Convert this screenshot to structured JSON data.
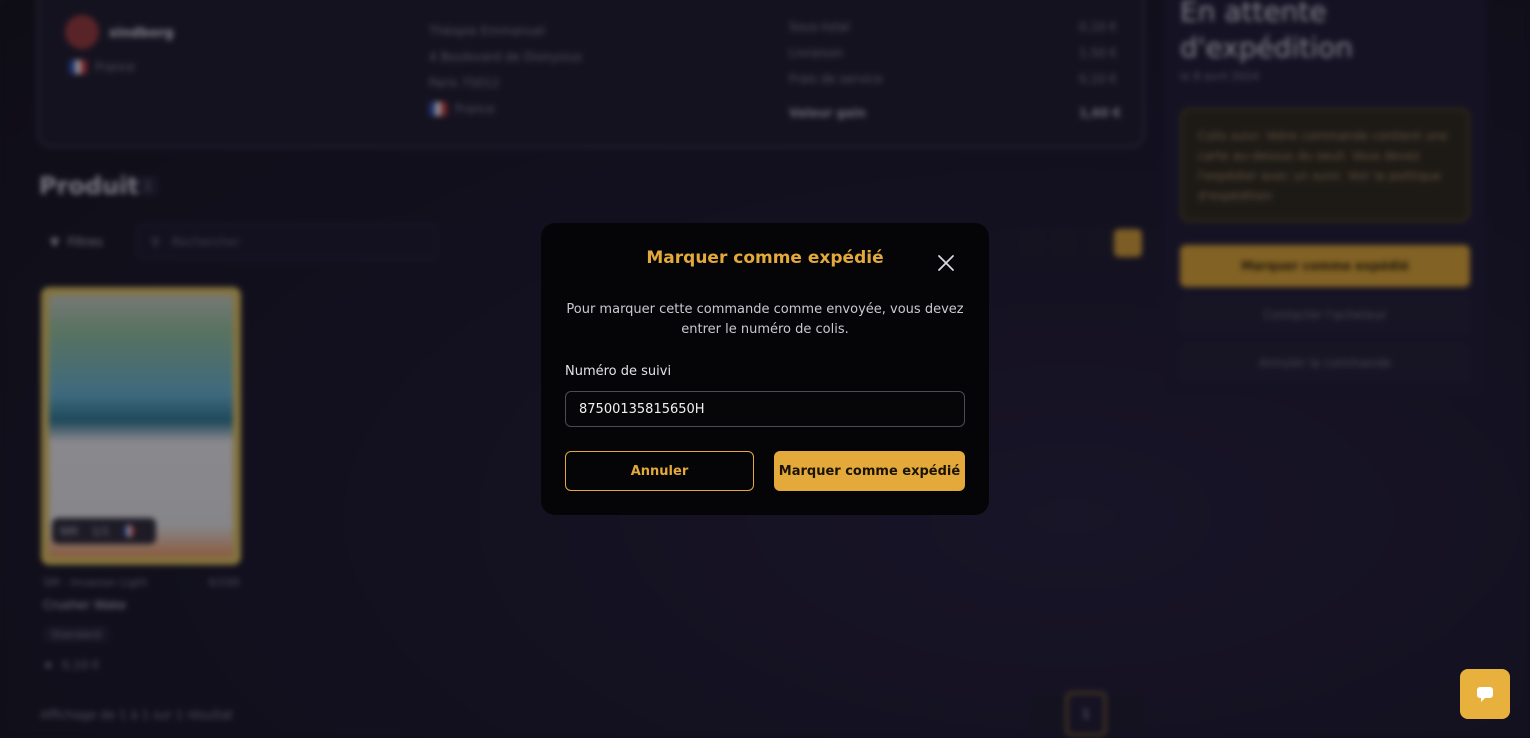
{
  "background": {
    "seller": {
      "name": "sindborg",
      "country": "France"
    },
    "address": {
      "lines": [
        "Théopie Emmanuel",
        "4 Boulevard de Dionysius",
        "Paris 75012"
      ],
      "country": "France"
    },
    "totals": {
      "rows": [
        {
          "label": "Sous-total",
          "value": "0,10 €"
        },
        {
          "label": "Livraison",
          "value": "1,50 €"
        },
        {
          "label": "Frais de service",
          "value": "0,10 €"
        }
      ],
      "total_label": "Valeur gain",
      "total_value": "1,60 €"
    },
    "products_title": "Produit",
    "products_count": "1",
    "filters_label": "Filtres",
    "search_placeholder": "Rechercher",
    "product": {
      "set": "SM - Invasion Light",
      "number": "0/100",
      "name": "Crusher Wake",
      "condition": "Standard",
      "price": "0,10 €",
      "badge_lang": "NM",
      "badge_qty": "1/1"
    },
    "results_text": "Affichage de 1 à 1 sur 1 résultat",
    "page_current": "1",
    "status_title": "En attente d'expédition",
    "status_date": "le 8 avril 2024",
    "notice": "Colis suivi: Votre commande contient une carte au-dessus du seuil. Vous devez l'expédier avec un suivi. Voir la politique d'expédition",
    "actions": {
      "ship": "Marquer comme expédié",
      "contact": "Contacter l'acheteur",
      "cancel": "Annuler la commande"
    }
  },
  "modal": {
    "title": "Marquer comme expédié",
    "description": "Pour marquer cette commande comme envoyée, vous devez entrer le numéro de colis.",
    "tracking_label": "Numéro de suivi",
    "tracking_value": "87500135815650H",
    "cancel_label": "Annuler",
    "confirm_label": "Marquer comme expédié"
  },
  "colors": {
    "accent": "#e3a93a",
    "modal_bg": "#050508",
    "page_bg": "#15141f"
  }
}
